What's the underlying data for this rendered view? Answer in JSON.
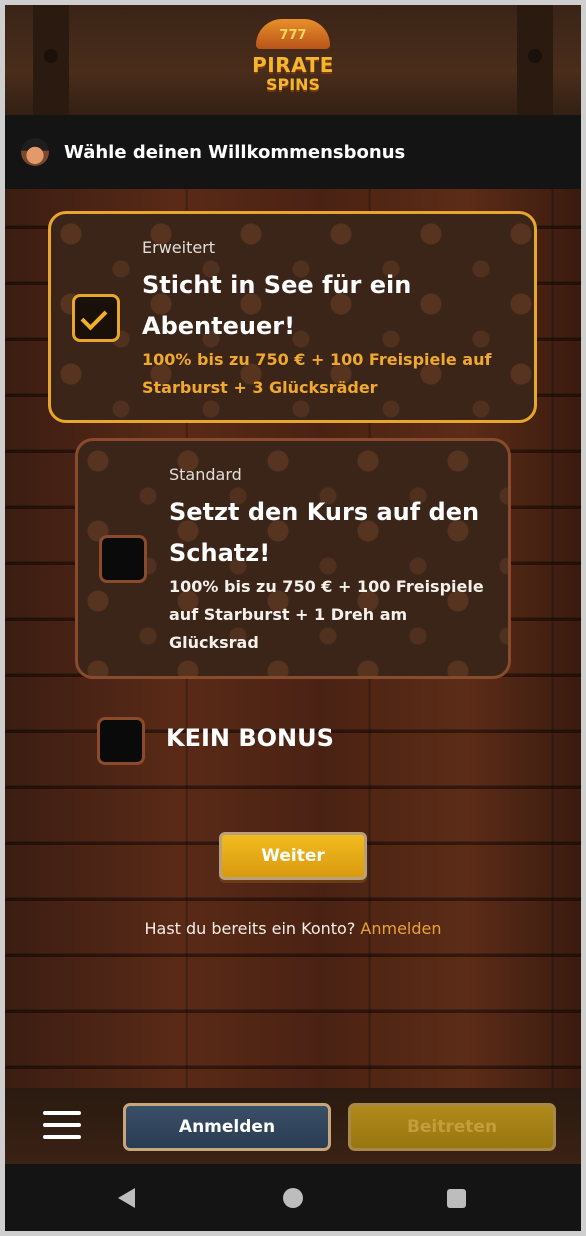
{
  "header": {
    "logo": {
      "badge": "777",
      "line1": "PIRATE",
      "line2": "SPINS"
    },
    "subtitle": "Wähle deinen Willkommensbonus",
    "subtitle_icon": "pirate-avatar-icon"
  },
  "bonus_options": [
    {
      "tier": "Erweitert",
      "title_line1": "Sticht in See für ein",
      "title_line2": "Abenteuer!",
      "desc_line1": "100% bis zu 750 € + 100 Freispiele auf",
      "desc_line2": "Starburst + 3 Glücksräder",
      "selected": true
    },
    {
      "tier": "Standard",
      "title_line1": "Setzt den Kurs auf den",
      "title_line2": "Schatz!",
      "desc_line1": "100% bis zu 750 € + 100 Freispiele",
      "desc_line2": "auf Starburst + 1 Dreh am",
      "desc_line3": "Glücksrad",
      "selected": false
    }
  ],
  "no_bonus": {
    "label": "KEIN BONUS",
    "selected": false
  },
  "continue_label": "Weiter",
  "login_prompt": {
    "text": "Hast du bereits ein Konto?",
    "link": "Anmelden"
  },
  "bottom_bar": {
    "menu_icon": "hamburger-menu-icon",
    "login_label": "Anmelden",
    "join_label": "Beitreten"
  },
  "colors": {
    "accent": "#e8a62a",
    "link": "#e8a23a",
    "card_border": "#8a4b2c"
  }
}
